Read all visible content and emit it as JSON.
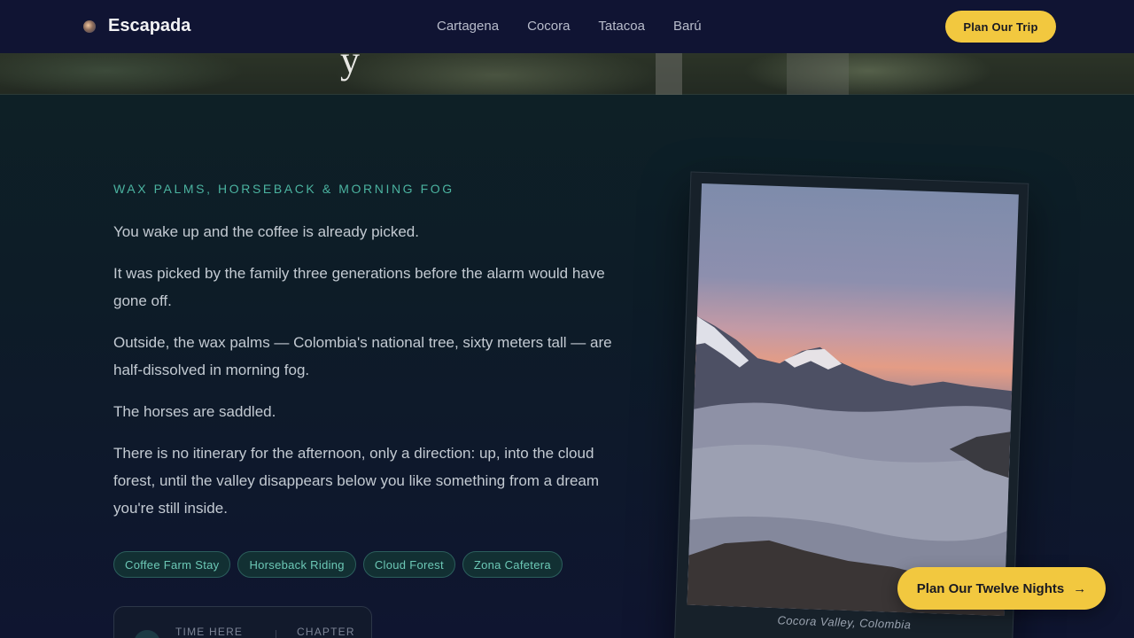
{
  "nav": {
    "brand": "Escapada",
    "links": [
      "Cartagena",
      "Cocora",
      "Tatacoa",
      "Barú"
    ],
    "cta": "Plan Our Trip"
  },
  "hero": {
    "title_fragment": "y"
  },
  "section": {
    "eyebrow": "WAX PALMS, HORSEBACK & MORNING FOG",
    "paragraphs": [
      "You wake up and the coffee is already picked.",
      "It was picked by the family three generations before the alarm would have gone off.",
      "Outside, the wax palms — Colombia's national tree, sixty meters tall — are half-dissolved in morning fog.",
      "The horses are saddled.",
      "There is no itinerary for the afternoon, only a direction: up, into the cloud forest, until the valley disappears below you like something from a dream you're still inside."
    ],
    "tags": [
      "Coffee Farm Stay",
      "Horseback Riding",
      "Cloud Forest",
      "Zona Cafetera"
    ],
    "info": {
      "time_label": "TIME HERE",
      "chapter_label": "CHAPTER"
    },
    "photo_caption": "Cocora Valley, Colombia"
  },
  "float_cta": {
    "label": "Plan Our Twelve Nights",
    "icon": "arrow-right-icon"
  },
  "colors": {
    "accent": "#f2c83f",
    "teal": "#4bb3a0",
    "nav_bg": "#101433"
  }
}
